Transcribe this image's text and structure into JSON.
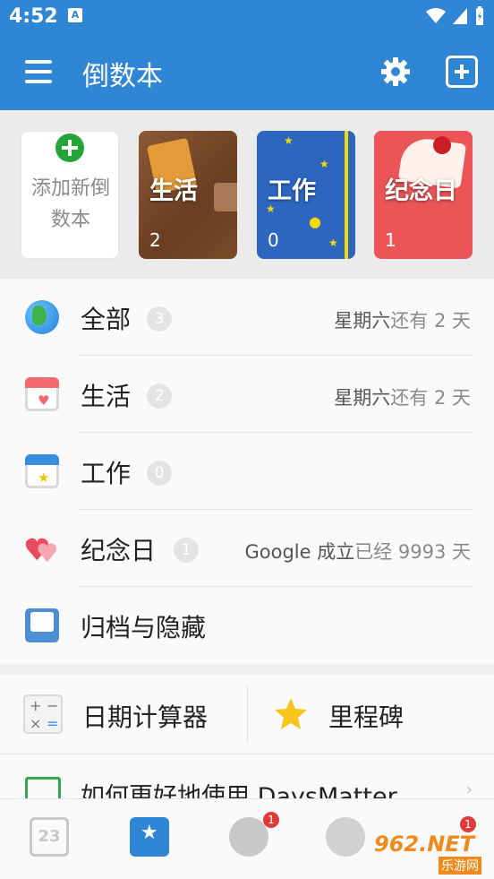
{
  "status_bar": {
    "time": "4:52",
    "notification": "A"
  },
  "app_bar": {
    "title": "倒数本"
  },
  "books": [
    {
      "id": "add",
      "label": "添加新倒数本"
    },
    {
      "id": "life",
      "title": "生活",
      "count": "2"
    },
    {
      "id": "work",
      "title": "工作",
      "count": "0"
    },
    {
      "id": "anniversary",
      "title": "纪念日",
      "count": "1"
    }
  ],
  "categories": [
    {
      "name": "全部",
      "count": "3",
      "date_name": "星期六",
      "date_text": "还有 2 天",
      "icon": "globe-icon"
    },
    {
      "name": "生活",
      "count": "2",
      "date_name": "星期六",
      "date_text": "还有 2 天",
      "icon": "calendar-heart-icon"
    },
    {
      "name": "工作",
      "count": "0",
      "date_name": "",
      "date_text": "",
      "icon": "calendar-star-icon"
    },
    {
      "name": "纪念日",
      "count": "1",
      "date_name": "Google 成立",
      "date_text": "已经 9993 天",
      "icon": "hearts-icon"
    },
    {
      "name": "归档与隐藏",
      "icon": "archive-icon"
    }
  ],
  "tools": {
    "calculator": "日期计算器",
    "milestone": "里程碑"
  },
  "tip": {
    "text": "如何更好地使用 DaysMatter"
  },
  "bottom_nav": {
    "calendar_day": "23",
    "planet_badge": "1",
    "profile_badge": "1"
  },
  "watermark": {
    "main": "962.NET",
    "sub": "乐游网"
  },
  "colors": {
    "primary": "#2f86d4",
    "work_book": "#2c66bf",
    "anniv_book": "#ec5557",
    "badge": "#e03b3b"
  }
}
